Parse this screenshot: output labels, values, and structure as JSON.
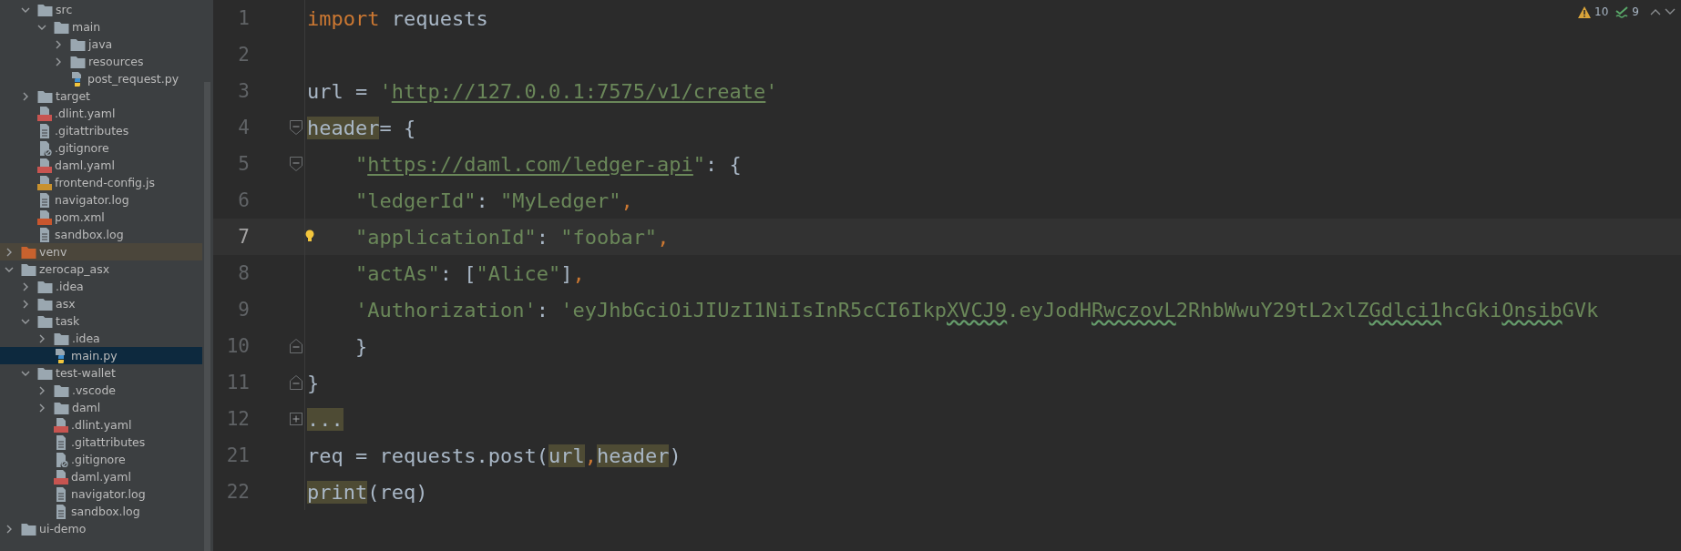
{
  "project_tree": [
    {
      "children": [
        {
          "label": "src",
          "kind": "folder",
          "expanded": true,
          "selected": false,
          "children": [
            {
              "label": "main",
              "kind": "folder",
              "expanded": true,
              "selected": false,
              "children": [
                {
                  "label": "java",
                  "kind": "folder",
                  "expanded": false,
                  "selected": false
                },
                {
                  "label": "resources",
                  "kind": "folder",
                  "expanded": false,
                  "selected": false
                },
                {
                  "label": "post_request.py",
                  "kind": "python",
                  "selected": false
                }
              ]
            }
          ]
        },
        {
          "label": "target",
          "kind": "folder",
          "expanded": false,
          "selected": false
        },
        {
          "label": ".dlint.yaml",
          "kind": "yaml",
          "selected": false
        },
        {
          "label": ".gitattributes",
          "kind": "text",
          "selected": false
        },
        {
          "label": ".gitignore",
          "kind": "ignore",
          "selected": false
        },
        {
          "label": "daml.yaml",
          "kind": "yaml",
          "selected": false
        },
        {
          "label": "frontend-config.js",
          "kind": "js",
          "selected": false
        },
        {
          "label": "navigator.log",
          "kind": "text",
          "selected": false
        },
        {
          "label": "pom.xml",
          "kind": "xml",
          "selected": false
        },
        {
          "label": "sandbox.log",
          "kind": "text",
          "selected": false
        }
      ]
    },
    {
      "label": "venv",
      "kind": "excluded",
      "expanded": false,
      "selected": false
    },
    {
      "label": "zerocap_asx",
      "kind": "folder",
      "expanded": true,
      "selected": false,
      "children": [
        {
          "label": ".idea",
          "kind": "folder",
          "expanded": false,
          "selected": false
        },
        {
          "label": "asx",
          "kind": "folder",
          "expanded": false,
          "selected": false
        },
        {
          "label": "task",
          "kind": "folder",
          "expanded": true,
          "selected": false,
          "children": [
            {
              "label": ".idea",
              "kind": "folder",
              "expanded": false,
              "selected": false
            },
            {
              "label": "main.py",
              "kind": "python",
              "selected": true
            }
          ]
        },
        {
          "label": "test-wallet",
          "kind": "folder",
          "expanded": true,
          "selected": false,
          "children": [
            {
              "label": ".vscode",
              "kind": "folder",
              "expanded": false,
              "selected": false
            },
            {
              "label": "daml",
              "kind": "folder",
              "expanded": false,
              "selected": false
            },
            {
              "label": ".dlint.yaml",
              "kind": "yaml",
              "selected": false
            },
            {
              "label": ".gitattributes",
              "kind": "text",
              "selected": false
            },
            {
              "label": ".gitignore",
              "kind": "ignore",
              "selected": false
            },
            {
              "label": "daml.yaml",
              "kind": "yaml",
              "selected": false
            },
            {
              "label": "navigator.log",
              "kind": "text",
              "selected": false
            },
            {
              "label": "sandbox.log",
              "kind": "text",
              "selected": false
            }
          ]
        }
      ]
    },
    {
      "label": "ui-demo",
      "kind": "folder",
      "expanded": false,
      "selected": false
    }
  ],
  "inspections": {
    "warnings": "10",
    "typos": "9"
  },
  "editor_lines": [
    {
      "number": "1",
      "current": false,
      "bulb": false,
      "tokens": [
        {
          "kind": "kw",
          "text": "import"
        },
        {
          "kind": "id",
          "text": " requests"
        }
      ]
    },
    {
      "number": "2",
      "current": false,
      "bulb": false
    },
    {
      "number": "3",
      "current": false,
      "bulb": false,
      "tokens": [
        {
          "kind": "id",
          "text": "url = "
        },
        {
          "kind": "str",
          "text": "'"
        },
        {
          "kind": "url",
          "text": "http://127.0.0.1:7575/v1/create"
        },
        {
          "kind": "str",
          "text": "'"
        }
      ]
    },
    {
      "number": "4",
      "current": false,
      "bulb": false,
      "fold": {
        "kind": "open"
      },
      "tokens": [
        {
          "kind": "hl",
          "text": "header"
        },
        {
          "kind": "id",
          "text": "= {"
        }
      ]
    },
    {
      "number": "5",
      "current": false,
      "bulb": false,
      "fold": {
        "kind": "open"
      },
      "indented": true,
      "tokens": [
        {
          "kind": "str",
          "text": "\""
        },
        {
          "kind": "url",
          "text": "https://daml.com/ledger-api"
        },
        {
          "kind": "str",
          "text": "\""
        },
        {
          "kind": "id",
          "text": ": {"
        }
      ]
    },
    {
      "number": "6",
      "current": false,
      "bulb": false,
      "indented": true,
      "tokens": [
        {
          "kind": "str",
          "text": "\"ledgerId\""
        },
        {
          "kind": "id",
          "text": ": "
        },
        {
          "kind": "str",
          "text": "\"MyLedger\""
        },
        {
          "kind": "punct",
          "text": ","
        }
      ]
    },
    {
      "number": "7",
      "current": true,
      "bulb": true,
      "indented": true,
      "tokens": [
        {
          "kind": "str",
          "text": "\"applicationId\""
        },
        {
          "kind": "id",
          "text": ": "
        },
        {
          "kind": "str",
          "text": "\"foobar\""
        },
        {
          "kind": "punct",
          "text": ","
        }
      ]
    },
    {
      "number": "8",
      "current": false,
      "bulb": false,
      "indented": true,
      "tokens": [
        {
          "kind": "str",
          "text": "\"actAs\""
        },
        {
          "kind": "id",
          "text": ": ["
        },
        {
          "kind": "str",
          "text": "\"Alice\""
        },
        {
          "kind": "id",
          "text": "]"
        },
        {
          "kind": "punct",
          "text": ","
        }
      ]
    },
    {
      "number": "9",
      "current": false,
      "bulb": false,
      "indented": true,
      "tokens": [
        {
          "kind": "str",
          "text": "'Authorization'"
        },
        {
          "kind": "id",
          "text": ": "
        },
        {
          "kind": "str",
          "text": "'eyJhbGciOiJIUzI1NiIsInR5cCI6Ikp"
        },
        {
          "kind": "typo",
          "text": "XVCJ9"
        },
        {
          "kind": "str",
          "text": ".eyJodH"
        },
        {
          "kind": "typo",
          "text": "RwczovL"
        },
        {
          "kind": "str",
          "text": "2RhbWwuY29tL2xlZ"
        },
        {
          "kind": "typo",
          "text": "Gdlci1"
        },
        {
          "kind": "str",
          "text": "hcGki"
        },
        {
          "kind": "typo",
          "text": "Onsib"
        },
        {
          "kind": "str",
          "text": "GVk"
        }
      ]
    },
    {
      "number": "10",
      "current": false,
      "bulb": false,
      "fold": {
        "kind": "close"
      },
      "indented": true,
      "tokens": [
        {
          "kind": "id",
          "text": "}"
        }
      ]
    },
    {
      "number": "11",
      "current": false,
      "bulb": false,
      "fold": {
        "kind": "close"
      },
      "tokens": [
        {
          "kind": "id",
          "text": "}"
        }
      ]
    },
    {
      "number": "12",
      "current": false,
      "bulb": false,
      "fold": {
        "kind": "collapsed"
      },
      "tokens": [
        {
          "kind": "folded",
          "text": "..."
        }
      ]
    },
    {
      "number": "21",
      "current": false,
      "bulb": false,
      "tokens": [
        {
          "kind": "id",
          "text": "req = requests.post("
        },
        {
          "kind": "hl",
          "text": "url"
        },
        {
          "kind": "punct",
          "text": ","
        },
        {
          "kind": "hl",
          "text": "header"
        },
        {
          "kind": "id",
          "text": ")"
        }
      ]
    },
    {
      "number": "22",
      "current": false,
      "bulb": false,
      "tokens": [
        {
          "kind": "hl",
          "text": "print"
        },
        {
          "kind": "id",
          "text": "(req)"
        }
      ]
    }
  ]
}
